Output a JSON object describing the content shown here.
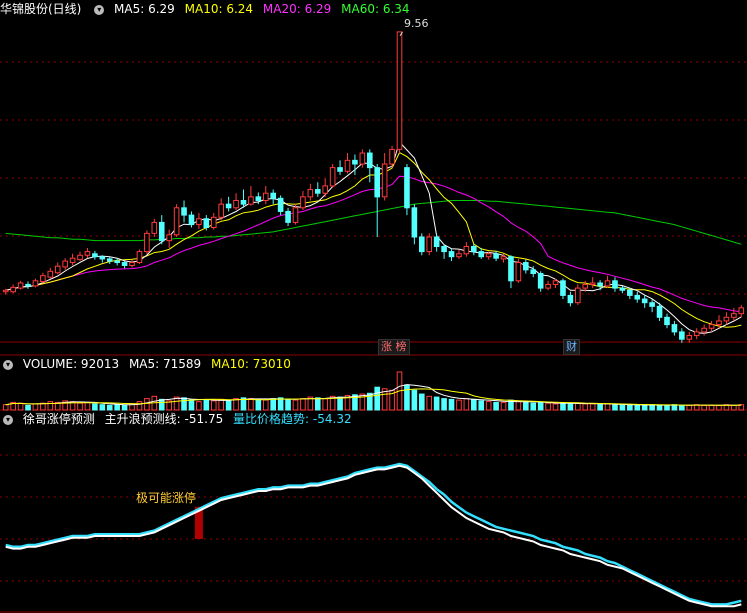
{
  "header": {
    "stock_name": "华锦股份(日线)",
    "ma5": "MA5: 6.29",
    "ma10": "MA10: 6.24",
    "ma20": "MA20: 6.29",
    "ma60": "MA60: 6.34"
  },
  "volume_header": {
    "volume": "VOLUME: 92013",
    "ma5": "MA5: 71589",
    "ma10": "MA10: 73010"
  },
  "indicator_header": {
    "name": "徐哥涨停预测",
    "main": "主升浪预测线: -51.75",
    "trend": "量比价格趋势: -54.32"
  },
  "annotations": {
    "peak_price": "9.56",
    "limit_up_tag": "涨 榜",
    "finance_tag": "财",
    "signal_text": "极可能涨停"
  },
  "colors": {
    "up": "#ff3b3b",
    "down": "#54ffff",
    "ma5": "#ffffff",
    "ma10": "#ffff00",
    "ma20": "#ff00ff",
    "ma60": "#00cc00",
    "grid": "#8b0000",
    "signal_bar": "#b00000",
    "indicator_main": "#ffffff",
    "indicator_trend": "#33e0ff"
  },
  "chart_data": {
    "type": "candlestick",
    "price_range": [
      5.75,
      9.75
    ],
    "candles": [
      [
        6.0,
        6.02,
        6.04,
        5.96
      ],
      [
        6.0,
        6.06,
        6.1,
        5.98
      ],
      [
        6.05,
        6.12,
        6.15,
        6.03
      ],
      [
        6.1,
        6.08,
        6.14,
        6.04
      ],
      [
        6.08,
        6.15,
        6.18,
        6.06
      ],
      [
        6.14,
        6.22,
        6.26,
        6.12
      ],
      [
        6.2,
        6.28,
        6.33,
        6.18
      ],
      [
        6.26,
        6.35,
        6.4,
        6.24
      ],
      [
        6.34,
        6.42,
        6.46,
        6.3
      ],
      [
        6.4,
        6.46,
        6.52,
        6.36
      ],
      [
        6.44,
        6.5,
        6.55,
        6.42
      ],
      [
        6.5,
        6.55,
        6.6,
        6.46
      ],
      [
        6.52,
        6.48,
        6.56,
        6.44
      ],
      [
        6.48,
        6.45,
        6.5,
        6.4
      ],
      [
        6.45,
        6.42,
        6.48,
        6.38
      ],
      [
        6.42,
        6.4,
        6.46,
        6.36
      ],
      [
        6.4,
        6.36,
        6.42,
        6.32
      ],
      [
        6.36,
        6.4,
        6.44,
        6.33
      ],
      [
        6.4,
        6.55,
        6.58,
        6.38
      ],
      [
        6.55,
        6.8,
        6.84,
        6.52
      ],
      [
        6.8,
        6.95,
        7.0,
        6.75
      ],
      [
        6.95,
        6.7,
        7.05,
        6.65
      ],
      [
        6.7,
        6.78,
        6.85,
        6.6
      ],
      [
        6.78,
        7.15,
        7.2,
        6.75
      ],
      [
        7.15,
        7.05,
        7.25,
        6.95
      ],
      [
        7.05,
        6.92,
        7.1,
        6.88
      ],
      [
        6.92,
        7.0,
        7.08,
        6.86
      ],
      [
        7.0,
        6.88,
        7.05,
        6.84
      ],
      [
        6.88,
        7.02,
        7.08,
        6.85
      ],
      [
        7.02,
        7.2,
        7.28,
        6.98
      ],
      [
        7.2,
        7.15,
        7.3,
        7.1
      ],
      [
        7.15,
        7.25,
        7.35,
        7.12
      ],
      [
        7.25,
        7.2,
        7.4,
        7.15
      ],
      [
        7.2,
        7.3,
        7.45,
        7.18
      ],
      [
        7.3,
        7.25,
        7.36,
        7.2
      ],
      [
        7.25,
        7.35,
        7.45,
        7.2
      ],
      [
        7.35,
        7.28,
        7.4,
        7.2
      ],
      [
        7.28,
        7.1,
        7.32,
        7.05
      ],
      [
        7.1,
        6.95,
        7.15,
        6.9
      ],
      [
        6.95,
        7.15,
        7.2,
        6.92
      ],
      [
        7.15,
        7.3,
        7.38,
        7.12
      ],
      [
        7.3,
        7.4,
        7.48,
        7.25
      ],
      [
        7.4,
        7.35,
        7.5,
        7.3
      ],
      [
        7.35,
        7.45,
        7.55,
        7.3
      ],
      [
        7.45,
        7.7,
        7.75,
        7.42
      ],
      [
        7.7,
        7.65,
        7.8,
        7.6
      ],
      [
        7.65,
        7.8,
        7.9,
        7.62
      ],
      [
        7.8,
        7.75,
        7.88,
        7.6
      ],
      [
        7.75,
        7.9,
        7.95,
        7.7
      ],
      [
        7.9,
        7.7,
        7.95,
        7.5
      ],
      [
        7.7,
        7.3,
        7.75,
        6.75
      ],
      [
        7.3,
        7.75,
        7.9,
        7.25
      ],
      [
        7.75,
        7.95,
        8.0,
        7.7
      ],
      [
        7.95,
        9.56,
        9.56,
        7.9
      ],
      [
        7.7,
        7.15,
        7.75,
        7.05
      ],
      [
        7.15,
        6.75,
        7.2,
        6.65
      ],
      [
        6.75,
        6.55,
        6.8,
        6.5
      ],
      [
        6.55,
        6.75,
        6.8,
        6.5
      ],
      [
        6.75,
        6.62,
        6.78,
        6.55
      ],
      [
        6.62,
        6.55,
        6.65,
        6.45
      ],
      [
        6.55,
        6.48,
        6.6,
        6.42
      ],
      [
        6.48,
        6.52,
        6.58,
        6.45
      ],
      [
        6.52,
        6.62,
        6.68,
        6.48
      ],
      [
        6.62,
        6.55,
        6.66,
        6.5
      ],
      [
        6.55,
        6.48,
        6.6,
        6.45
      ],
      [
        6.48,
        6.52,
        6.55,
        6.44
      ],
      [
        6.52,
        6.46,
        6.56,
        6.42
      ],
      [
        6.45,
        6.48,
        6.52,
        6.4
      ],
      [
        6.48,
        6.15,
        6.5,
        6.05
      ],
      [
        6.15,
        6.4,
        6.45,
        6.12
      ],
      [
        6.4,
        6.3,
        6.44,
        6.25
      ],
      [
        6.3,
        6.25,
        6.35,
        6.2
      ],
      [
        6.25,
        6.05,
        6.28,
        6.0
      ],
      [
        6.05,
        6.1,
        6.15,
        6.02
      ],
      [
        6.1,
        6.15,
        6.18,
        6.05
      ],
      [
        6.15,
        5.95,
        6.18,
        5.9
      ],
      [
        5.95,
        5.85,
        6.0,
        5.8
      ],
      [
        5.85,
        6.05,
        6.1,
        5.82
      ],
      [
        6.05,
        6.1,
        6.15,
        6.0
      ],
      [
        6.1,
        6.12,
        6.2,
        6.05
      ],
      [
        6.12,
        6.08,
        6.16,
        6.02
      ],
      [
        6.08,
        6.15,
        6.22,
        6.05
      ],
      [
        6.15,
        6.05,
        6.2,
        6.0
      ],
      [
        6.05,
        6.02,
        6.08,
        5.98
      ],
      [
        6.02,
        5.95,
        6.05,
        5.9
      ],
      [
        5.95,
        5.9,
        6.0,
        5.85
      ],
      [
        5.9,
        5.85,
        5.95,
        5.78
      ],
      [
        5.85,
        5.8,
        5.9,
        5.72
      ],
      [
        5.8,
        5.65,
        5.85,
        5.6
      ],
      [
        5.65,
        5.55,
        5.7,
        5.5
      ],
      [
        5.55,
        5.45,
        5.6,
        5.4
      ],
      [
        5.45,
        5.35,
        5.5,
        5.3
      ],
      [
        5.35,
        5.4,
        5.45,
        5.3
      ],
      [
        5.4,
        5.45,
        5.5,
        5.35
      ],
      [
        5.45,
        5.5,
        5.55,
        5.4
      ],
      [
        5.5,
        5.55,
        5.6,
        5.45
      ],
      [
        5.55,
        5.6,
        5.68,
        5.5
      ],
      [
        5.6,
        5.65,
        5.72,
        5.55
      ],
      [
        5.65,
        5.7,
        5.78,
        5.6
      ],
      [
        5.7,
        5.78,
        5.82,
        5.65
      ]
    ],
    "volumes": [
      0.14,
      0.2,
      0.18,
      0.12,
      0.16,
      0.18,
      0.22,
      0.2,
      0.24,
      0.22,
      0.18,
      0.2,
      0.16,
      0.14,
      0.12,
      0.14,
      0.12,
      0.16,
      0.22,
      0.3,
      0.36,
      0.28,
      0.24,
      0.34,
      0.32,
      0.26,
      0.22,
      0.26,
      0.24,
      0.28,
      0.26,
      0.3,
      0.32,
      0.3,
      0.28,
      0.26,
      0.3,
      0.32,
      0.28,
      0.26,
      0.3,
      0.34,
      0.32,
      0.3,
      0.36,
      0.34,
      0.38,
      0.4,
      0.42,
      0.44,
      0.6,
      0.56,
      0.52,
      1.0,
      0.66,
      0.52,
      0.42,
      0.36,
      0.34,
      0.3,
      0.28,
      0.26,
      0.3,
      0.28,
      0.24,
      0.22,
      0.2,
      0.2,
      0.26,
      0.22,
      0.2,
      0.18,
      0.2,
      0.18,
      0.16,
      0.18,
      0.16,
      0.18,
      0.16,
      0.16,
      0.14,
      0.16,
      0.14,
      0.14,
      0.12,
      0.12,
      0.14,
      0.14,
      0.12,
      0.12,
      0.14,
      0.12,
      0.12,
      0.14,
      0.12,
      0.12,
      0.12,
      0.14,
      0.12,
      0.14
    ],
    "ma60": [
      6.8,
      6.79,
      6.78,
      6.77,
      6.76,
      6.75,
      6.74,
      6.74,
      6.73,
      6.72,
      6.72,
      6.71,
      6.7,
      6.7,
      6.7,
      6.7,
      6.7,
      6.7,
      6.7,
      6.71,
      6.71,
      6.72,
      6.72,
      6.73,
      6.73,
      6.74,
      6.74,
      6.75,
      6.75,
      6.76,
      6.76,
      6.77,
      6.78,
      6.79,
      6.8,
      6.81,
      6.82,
      6.84,
      6.86,
      6.88,
      6.9,
      6.92,
      6.94,
      6.96,
      6.98,
      7.0,
      7.02,
      7.04,
      7.06,
      7.08,
      7.1,
      7.12,
      7.14,
      7.16,
      7.18,
      7.2,
      7.21,
      7.22,
      7.23,
      7.24,
      7.25,
      7.25,
      7.25,
      7.25,
      7.25,
      7.24,
      7.24,
      7.23,
      7.22,
      7.21,
      7.2,
      7.19,
      7.18,
      7.17,
      7.16,
      7.15,
      7.14,
      7.13,
      7.12,
      7.11,
      7.1,
      7.09,
      7.08,
      7.06,
      7.04,
      7.02,
      7.0,
      6.98,
      6.96,
      6.94,
      6.92,
      6.89,
      6.86,
      6.83,
      6.8,
      6.77,
      6.74,
      6.71,
      6.68,
      6.65
    ],
    "indicator_main": [
      0.66,
      0.67,
      0.67,
      0.66,
      0.66,
      0.65,
      0.64,
      0.63,
      0.62,
      0.61,
      0.61,
      0.61,
      0.6,
      0.6,
      0.6,
      0.6,
      0.6,
      0.6,
      0.6,
      0.59,
      0.58,
      0.56,
      0.54,
      0.52,
      0.5,
      0.48,
      0.46,
      0.44,
      0.42,
      0.4,
      0.39,
      0.38,
      0.37,
      0.36,
      0.35,
      0.35,
      0.34,
      0.34,
      0.33,
      0.33,
      0.33,
      0.32,
      0.32,
      0.31,
      0.3,
      0.29,
      0.28,
      0.26,
      0.25,
      0.24,
      0.23,
      0.23,
      0.22,
      0.21,
      0.22,
      0.25,
      0.28,
      0.32,
      0.36,
      0.4,
      0.44,
      0.47,
      0.5,
      0.52,
      0.54,
      0.56,
      0.57,
      0.58,
      0.6,
      0.61,
      0.62,
      0.63,
      0.65,
      0.66,
      0.67,
      0.68,
      0.7,
      0.71,
      0.72,
      0.73,
      0.74,
      0.76,
      0.77,
      0.78,
      0.8,
      0.82,
      0.84,
      0.86,
      0.88,
      0.9,
      0.92,
      0.94,
      0.96,
      0.97,
      0.98,
      0.99,
      0.99,
      0.99,
      0.99,
      0.98
    ],
    "indicator_trend": [
      0.65,
      0.66,
      0.66,
      0.65,
      0.65,
      0.64,
      0.63,
      0.62,
      0.61,
      0.6,
      0.6,
      0.6,
      0.59,
      0.59,
      0.59,
      0.59,
      0.59,
      0.59,
      0.59,
      0.58,
      0.57,
      0.55,
      0.53,
      0.51,
      0.49,
      0.47,
      0.45,
      0.43,
      0.41,
      0.39,
      0.38,
      0.37,
      0.36,
      0.35,
      0.34,
      0.34,
      0.33,
      0.33,
      0.32,
      0.32,
      0.32,
      0.31,
      0.31,
      0.3,
      0.29,
      0.28,
      0.27,
      0.25,
      0.24,
      0.23,
      0.22,
      0.22,
      0.21,
      0.2,
      0.21,
      0.24,
      0.27,
      0.3,
      0.34,
      0.37,
      0.41,
      0.44,
      0.47,
      0.49,
      0.51,
      0.53,
      0.55,
      0.56,
      0.57,
      0.58,
      0.59,
      0.6,
      0.62,
      0.63,
      0.64,
      0.66,
      0.67,
      0.68,
      0.7,
      0.71,
      0.72,
      0.74,
      0.75,
      0.77,
      0.79,
      0.81,
      0.83,
      0.85,
      0.87,
      0.89,
      0.91,
      0.93,
      0.95,
      0.96,
      0.97,
      0.98,
      0.98,
      0.98,
      0.97,
      0.96
    ],
    "signal_index": 26
  }
}
